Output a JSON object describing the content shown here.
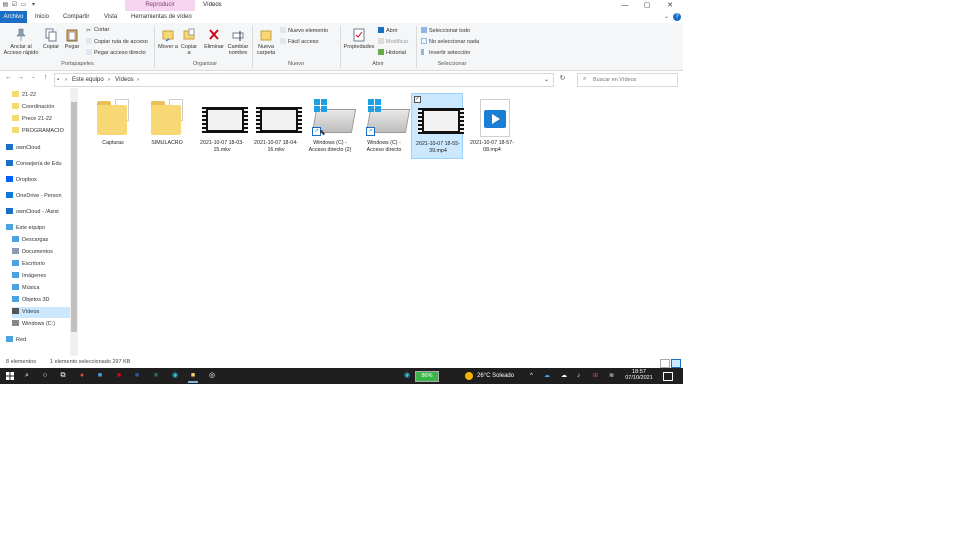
{
  "window": {
    "title": "Vídeos",
    "context_tab": "Reproducir",
    "minimize": "—",
    "maximize": "▢",
    "close": "✕"
  },
  "tabs": {
    "file": "Archivo",
    "home": "Inicio",
    "share": "Compartir",
    "view": "Vista",
    "video_tools": "Herramientas de vídeo",
    "help": "?"
  },
  "ribbon": {
    "clipboard": {
      "group": "Portapapeles",
      "pin": "Anclar al Acceso rápido",
      "copy": "Copiar",
      "paste": "Pegar",
      "cut": "Cortar",
      "copy_path": "Copiar ruta de acceso",
      "paste_shortcut": "Pegar acceso directo"
    },
    "organize": {
      "group": "Organizar",
      "move": "Mover a",
      "copy_to": "Copiar a",
      "delete": "Eliminar",
      "rename": "Cambiar nombre"
    },
    "new": {
      "group": "Nuevo",
      "new_folder": "Nueva carpeta",
      "new_item": "Nuevo elemento",
      "easy_access": "Fácil acceso"
    },
    "open": {
      "group": "Abrir",
      "properties": "Propiedades",
      "open": "Abrir",
      "edit": "Modificar",
      "history": "Historial"
    },
    "select": {
      "group": "Seleccionar",
      "select_all": "Seleccionar todo",
      "select_none": "No seleccionar nada",
      "invert": "Invertir selección"
    }
  },
  "address": {
    "path": [
      "Este equipo",
      "Vídeos"
    ],
    "search_placeholder": "Buscar en Vídeos"
  },
  "nav_items": [
    {
      "label": "21-22",
      "icon": "folder-icon"
    },
    {
      "label": "Coordinación",
      "icon": "folder-icon"
    },
    {
      "label": "Prece 21-22",
      "icon": "folder-icon"
    },
    {
      "label": "PROGRAMACIO",
      "icon": "folder-icon"
    },
    {
      "label": "ownCloud",
      "icon": "cloud-icon"
    },
    {
      "label": "Consejería de Edu",
      "icon": "people-icon"
    },
    {
      "label": "Dropbox",
      "icon": "dropbox-icon"
    },
    {
      "label": "OneDrive - Person",
      "icon": "onedrive-icon"
    },
    {
      "label": "ownCloud - /Asist",
      "icon": "cloud-icon"
    },
    {
      "label": "Este equipo",
      "icon": "pc-icon"
    },
    {
      "label": "Descargas",
      "icon": "download-icon"
    },
    {
      "label": "Documentos",
      "icon": "documents-icon"
    },
    {
      "label": "Escritorio",
      "icon": "desktop-icon"
    },
    {
      "label": "Imágenes",
      "icon": "pictures-icon"
    },
    {
      "label": "Música",
      "icon": "music-icon"
    },
    {
      "label": "Objetos 3D",
      "icon": "objects3d-icon"
    },
    {
      "label": "Vídeos",
      "icon": "videos-icon"
    },
    {
      "label": "Windows (C:)",
      "icon": "drive-icon"
    },
    {
      "label": "Red",
      "icon": "network-icon"
    }
  ],
  "files": [
    {
      "label": "Capturas",
      "type": "folder"
    },
    {
      "label": "SIMULACRO",
      "type": "folder"
    },
    {
      "label": "2021-10-07 18-03-15.mkv",
      "type": "video"
    },
    {
      "label": "2021-10-07 18-04-16.mkv",
      "type": "video"
    },
    {
      "label": "Windows (C) - Acceso directo (2)",
      "type": "shortcut"
    },
    {
      "label": "Windows (C) - Acceso directo",
      "type": "shortcut"
    },
    {
      "label": "2021-10-07 18-55-39.mp4",
      "type": "video",
      "selected": true
    },
    {
      "label": "2021-10-07 18-57-08.mp4",
      "type": "mp4"
    }
  ],
  "status": {
    "count": "8 elementos",
    "selection": "1 elemento seleccionado  297 KB"
  },
  "taskbar": {
    "battery": "86%",
    "weather": "26°C  Soleado",
    "time": "18:57",
    "date": "07/10/2021"
  },
  "colors": {
    "accent": "#1a6fc4",
    "selection": "#cce8ff",
    "context_tab": "#f7d4f0",
    "taskbar": "#1f1f1f"
  }
}
